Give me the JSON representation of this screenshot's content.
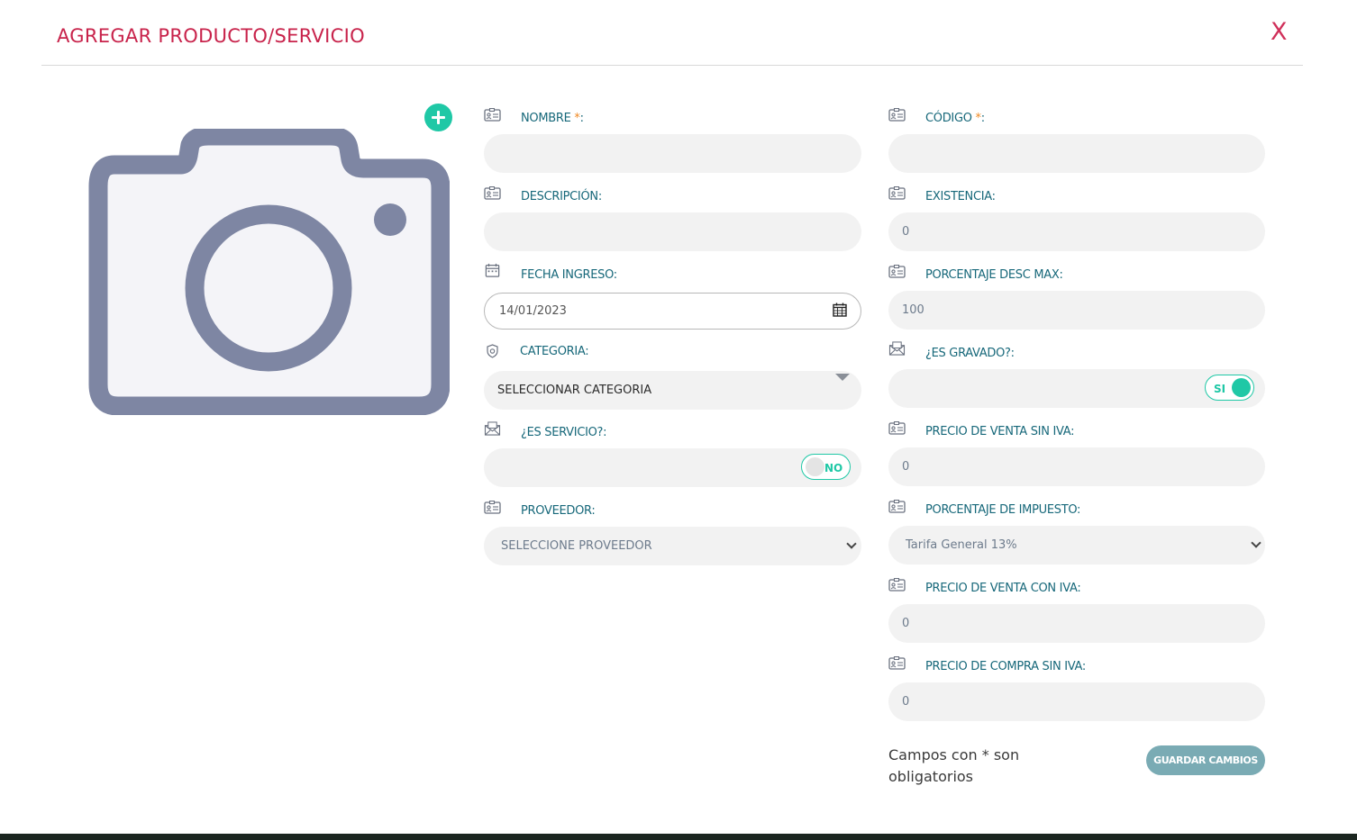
{
  "modal": {
    "title": "AGREGAR PRODUCTO/SERVICIO",
    "close_label": "X"
  },
  "photo": {
    "icon": "camera-icon",
    "add_icon": "plus-circle-icon"
  },
  "fields": {
    "nombre": {
      "label": "NOMBRE",
      "required": "*",
      "suffix": ":",
      "value": ""
    },
    "descripcion": {
      "label": "DESCRIPCIÓN:",
      "value": ""
    },
    "fecha_ingreso": {
      "label": "FECHA INGRESO:",
      "value": "14/01/2023"
    },
    "categoria": {
      "label": "CATEGORIA:",
      "selected": "SELECCIONAR CATEGORIA"
    },
    "es_servicio": {
      "label": "¿ES SERVICIO?:",
      "toggle": "NO"
    },
    "proveedor": {
      "label": "PROVEEDOR:",
      "selected": "SELECCIONE PROVEEDOR"
    },
    "codigo": {
      "label": "CÓDIGO",
      "required": "*",
      "suffix": ":",
      "value": ""
    },
    "existencia": {
      "label": "EXISTENCIA:",
      "value": "0"
    },
    "porcentaje_desc_max": {
      "label": "PORCENTAJE DESC MAX:",
      "value": "100"
    },
    "es_gravado": {
      "label": "¿ES GRAVADO?:",
      "toggle": "SI"
    },
    "precio_venta_sin_iva": {
      "label": "PRECIO DE VENTA SIN IVA:",
      "value": "0"
    },
    "porcentaje_impuesto": {
      "label": "PORCENTAJE DE IMPUESTO:",
      "selected": "Tarifa General 13%"
    },
    "precio_venta_con_iva": {
      "label": "PRECIO DE VENTA CON IVA:",
      "value": "0"
    },
    "precio_compra_sin_iva": {
      "label": "PRECIO DE COMPRA SIN IVA:",
      "value": "0"
    }
  },
  "footer": {
    "required_note": "Campos con * son obligatorios",
    "save_label": "GUARDAR CAMBIOS"
  },
  "colors": {
    "title": "#c8234b",
    "label": "#17687a",
    "accent": "#1fc8a6",
    "save_button": "#7aabb4",
    "camera": "#7e86a3"
  }
}
